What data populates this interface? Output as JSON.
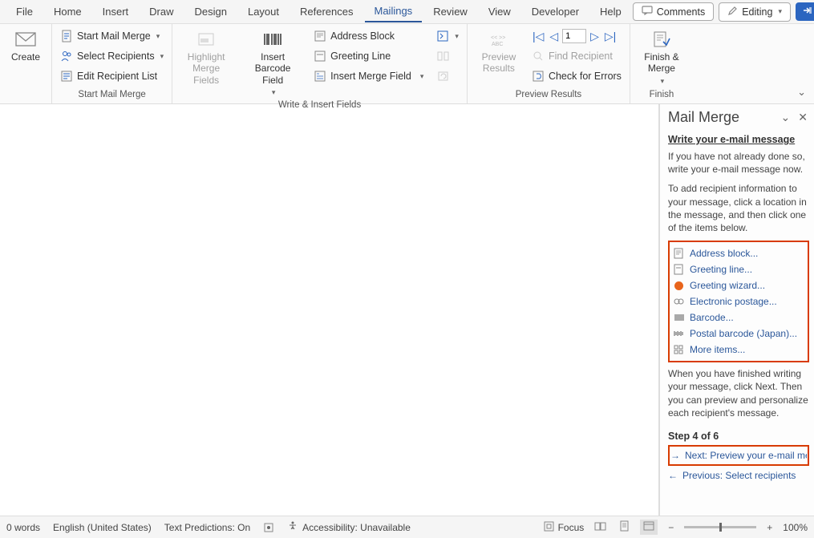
{
  "menu": {
    "items": [
      "File",
      "Home",
      "Insert",
      "Draw",
      "Design",
      "Layout",
      "References",
      "Mailings",
      "Review",
      "View",
      "Developer",
      "Help"
    ],
    "active": "Mailings",
    "comments": "Comments",
    "editing": "Editing"
  },
  "ribbon": {
    "create": {
      "label": "Create"
    },
    "start_group": {
      "start_merge": "Start Mail Merge",
      "select_recipients": "Select Recipients",
      "edit_recipients": "Edit Recipient List",
      "label": "Start Mail Merge"
    },
    "write_group": {
      "highlight": "Highlight Merge Fields",
      "barcode": "Insert Barcode Field",
      "address_block": "Address Block",
      "greeting_line": "Greeting Line",
      "insert_field": "Insert Merge Field",
      "label": "Write & Insert Fields"
    },
    "preview_group": {
      "preview": "Preview Results",
      "record": "1",
      "find_recipient": "Find Recipient",
      "check_errors": "Check for Errors",
      "label": "Preview Results"
    },
    "finish_group": {
      "finish": "Finish & Merge",
      "label": "Finish"
    }
  },
  "pane": {
    "title": "Mail Merge",
    "section_title": "Write your e-mail message",
    "para1": "If you have not already done so, write your e-mail message now.",
    "para2": "To add recipient information to your message, click a location in the message, and then click one of the items below.",
    "links": {
      "address": "Address block...",
      "greeting_line": "Greeting line...",
      "greeting_wizard": "Greeting wizard...",
      "postage": "Electronic postage...",
      "barcode": "Barcode...",
      "postal_jp": "Postal barcode (Japan)...",
      "more": "More items..."
    },
    "para3": "When you have finished writing your message, click Next. Then you can preview and personalize each recipient's message.",
    "step": "Step 4 of 6",
    "next": "Next: Preview your e-mail me",
    "prev": "Previous: Select recipients"
  },
  "status": {
    "words": "0 words",
    "language": "English (United States)",
    "predictions": "Text Predictions: On",
    "accessibility": "Accessibility: Unavailable",
    "focus": "Focus",
    "zoom": "100%"
  }
}
